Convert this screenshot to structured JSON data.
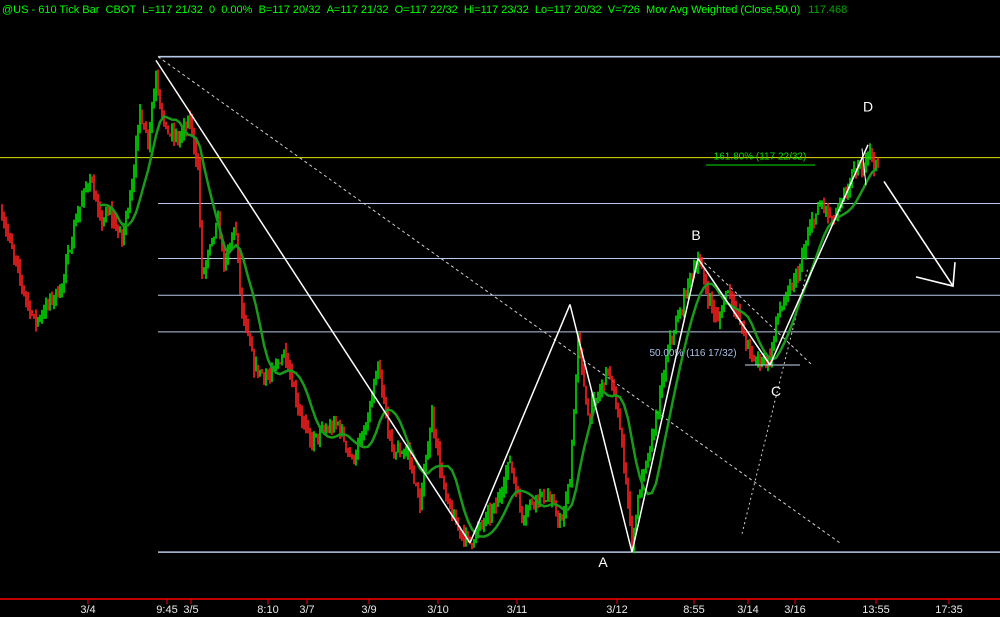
{
  "header": {
    "title": "@US - 610 Tick Bar",
    "exchange": "CBOT",
    "last": "L=117 21/32",
    "change": "0",
    "change_pct": "0.00%",
    "bid": "B=117 20/32",
    "ask": "A=117 21/32",
    "open": "O=117 22/32",
    "high": "Hi=117 23/32",
    "low": "Lo=117 20/32",
    "volume": "V=726",
    "indicator": "Mov Avg Weighted (Close,50,0)",
    "indicator_value": "117.468"
  },
  "colors": {
    "background": "#000000",
    "up_bar": "#00e000",
    "down_bar": "#ff2020",
    "moving_average": "#1a9a1a",
    "trend_line": "#ffffff",
    "level_line": "#b8c8e8",
    "target_line": "#e0e000",
    "axis_line": "#ff0000",
    "fib_label": "#00e000"
  },
  "chart_data": {
    "type": "bar",
    "title": "@US - 610 Tick Bar CBOT",
    "xlabel": "",
    "ylabel": "",
    "ylim": [
      115.25,
      118.4
    ],
    "x_tick_labels": [
      "3/4",
      "9:45",
      "3/5",
      "8:10",
      "3/7",
      "3/9",
      "3/10",
      "3/11",
      "3/12",
      "8:55",
      "3/14",
      "3/16",
      "13:55",
      "17:35"
    ],
    "moving_average_name": "Mov Avg Weighted (Close,50,0)",
    "moving_average_last": 117.468,
    "pattern_points": [
      {
        "label": "A",
        "price": 115.55
      },
      {
        "label": "B",
        "price": 117.1
      },
      {
        "label": "C",
        "price": 116.55
      },
      {
        "label": "D",
        "price": 117.7
      }
    ],
    "horizontal_levels": [
      118.2,
      117.65,
      117.4,
      117.1,
      116.9,
      116.7,
      115.5
    ],
    "fib_annotations": [
      {
        "text": "161.80% (117 22/32)",
        "price": 117.6875
      },
      {
        "text": "50.00% (116 17/32)",
        "price": 116.53125
      }
    ]
  }
}
